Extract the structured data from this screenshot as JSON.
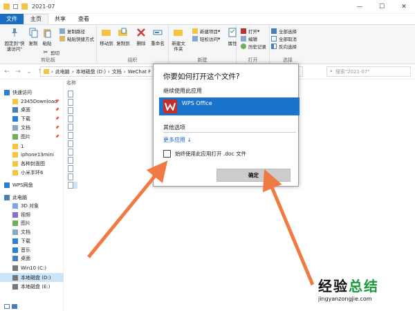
{
  "window": {
    "title": "2021-07"
  },
  "tabs": [
    "文件",
    "主页",
    "共享",
    "查看"
  ],
  "ribbon": {
    "clipboard": {
      "pin_label": "固定到\"快速访问\"",
      "copy_label": "复制",
      "paste_label": "粘贴",
      "copy_path": "复制路径",
      "paste_shortcut": "粘贴快捷方式",
      "cut": "剪切",
      "group": "剪贴板"
    },
    "organize": {
      "move_to": "移动到",
      "copy_to": "复制到",
      "delete": "删除",
      "rename": "重命名",
      "group": "组织"
    },
    "new": {
      "new_folder": "新建文件夹",
      "new_item": "新建项目",
      "easy_access": "轻松访问",
      "group": "新建"
    },
    "open": {
      "properties": "属性",
      "open": "打开",
      "edit": "编辑",
      "history": "历史记录",
      "group": "打开"
    },
    "select": {
      "select_all": "全部选择",
      "select_none": "全部取消",
      "invert": "反向选择",
      "group": "选择"
    }
  },
  "address": {
    "crumbs": [
      "此电脑",
      "本地磁盘 (D:)",
      "文档",
      "WeChat F"
    ],
    "search_placeholder": "搜索\"2021-07\""
  },
  "nav": {
    "items": [
      {
        "label": "快速访问",
        "icon": "star-icon"
      },
      {
        "label": "2345Download",
        "icon": "folder-icon",
        "pinned": true
      },
      {
        "label": "桌面",
        "icon": "desktop-icon",
        "pinned": true
      },
      {
        "label": "下载",
        "icon": "download-icon",
        "pinned": true
      },
      {
        "label": "文档",
        "icon": "document-icon",
        "pinned": true
      },
      {
        "label": "图片",
        "icon": "picture-icon",
        "pinned": true
      },
      {
        "label": "1",
        "icon": "folder-icon"
      },
      {
        "label": "iphone13mini",
        "icon": "folder-icon"
      },
      {
        "label": "各种封面图",
        "icon": "folder-icon"
      },
      {
        "label": "小米手环6",
        "icon": "folder-icon"
      },
      {
        "label": "WPS网盘",
        "icon": "cloud-icon"
      },
      {
        "label": "此电脑",
        "icon": "computer-icon"
      },
      {
        "label": "3D 对象",
        "icon": "cube-icon"
      },
      {
        "label": "视频",
        "icon": "video-icon"
      },
      {
        "label": "图片",
        "icon": "picture-icon"
      },
      {
        "label": "文档",
        "icon": "document-icon"
      },
      {
        "label": "下载",
        "icon": "download-icon"
      },
      {
        "label": "音乐",
        "icon": "music-icon"
      },
      {
        "label": "桌面",
        "icon": "desktop-icon"
      },
      {
        "label": "Win10 (C:)",
        "icon": "drive-icon"
      },
      {
        "label": "本地磁盘 (D:)",
        "icon": "drive-icon",
        "selected": true
      },
      {
        "label": "本地磁盘 (E:)",
        "icon": "drive-icon"
      }
    ]
  },
  "filelist": {
    "column_name": "名称"
  },
  "dialog": {
    "title": "你要如何打开这个文件?",
    "subtitle": "继续使用此应用",
    "app_name": "WPS Office",
    "other_options": "其他选项",
    "more_apps": "更多应用 ↓",
    "checkbox_label": "始终使用此应用打开 .doc 文件",
    "ok_label": "确定"
  },
  "watermark": {
    "line1_a": "经验",
    "line1_b": "总结",
    "line2": "jingyanzongjie.com"
  },
  "colors": {
    "accent": "#1a74cc",
    "arrow": "#f07a43",
    "wps": "#c22f2f"
  }
}
